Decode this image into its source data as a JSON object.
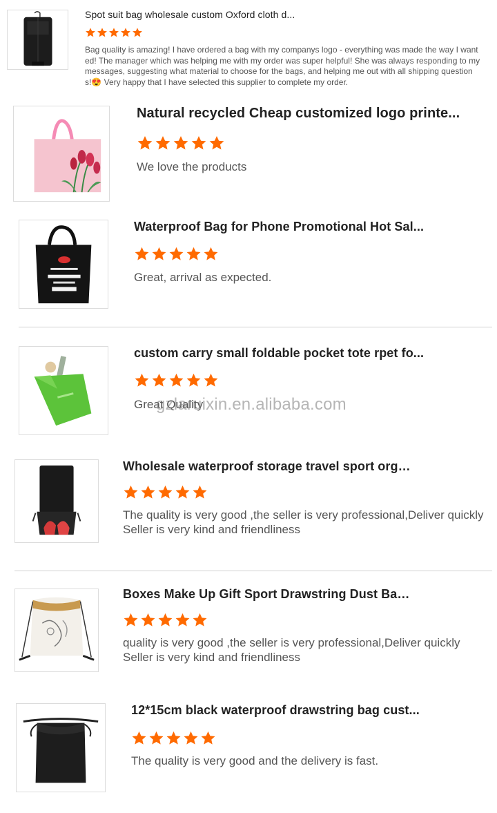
{
  "star_color": "#ff6a00",
  "watermark": "gzlaruixin.en.alibaba.com",
  "reviews": [
    {
      "title": "Spot suit bag wholesale custom Oxford cloth d...",
      "rating": 5,
      "lines": [
        "Bag quality is amazing! I have ordered a bag with my companys logo - everything was made the way I want",
        "ed! The manager which was helping me with my order was super helpful! She was always responding to my",
        "messages, suggesting what material to choose for the bags, and helping me out with all shipping question",
        "s!😍 Very happy that I have selected this supplier to complete my order."
      ],
      "image": "black-garment-bag"
    },
    {
      "title": "Natural recycled Cheap customized logo printe...",
      "rating": 5,
      "lines": [
        "We love the products"
      ],
      "image": "pink-tulip-tote"
    },
    {
      "title": "Waterproof Bag for Phone Promotional Hot Sal...",
      "rating": 5,
      "lines": [
        "Great, arrival as expected."
      ],
      "image": "black-groceries-tote"
    },
    {
      "title": "custom carry small foldable pocket tote rpet fo...",
      "rating": 5,
      "lines": [
        "Great Quality"
      ],
      "image": "green-foldable-tote"
    },
    {
      "title": "Wholesale waterproof storage travel sport orga...",
      "rating": 5,
      "lines": [
        "The quality is very good ,the seller is very professional,Deliver quickly",
        "Seller is very kind and friendliness"
      ],
      "image": "black-shoe-bag"
    },
    {
      "title": "Boxes Make Up Gift Sport Drawstring Dust Bag...",
      "rating": 5,
      "lines": [
        "quality is very good ,the seller is very professional,Deliver quickly",
        "Seller is very kind and friendliness"
      ],
      "image": "printed-drawstring-bag"
    },
    {
      "title": "12*15cm black waterproof drawstring bag cust...",
      "rating": 5,
      "lines": [
        "The quality is very good and the delivery is fast."
      ],
      "image": "black-drawstring-bag"
    }
  ]
}
